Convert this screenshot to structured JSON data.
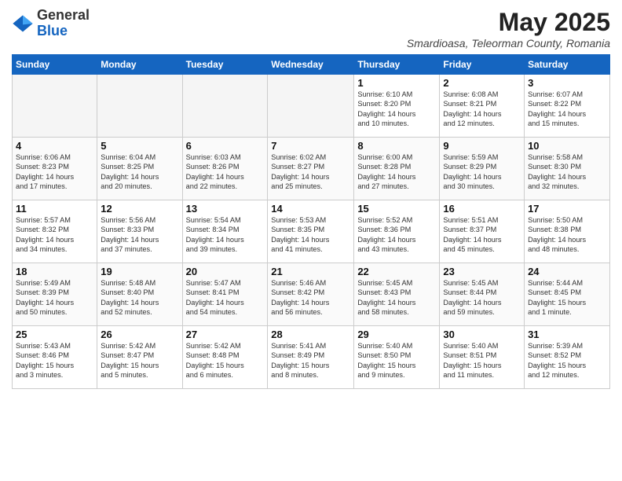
{
  "header": {
    "logo_general": "General",
    "logo_blue": "Blue",
    "month_year": "May 2025",
    "subtitle": "Smardioasa, Teleorman County, Romania"
  },
  "days_of_week": [
    "Sunday",
    "Monday",
    "Tuesday",
    "Wednesday",
    "Thursday",
    "Friday",
    "Saturday"
  ],
  "weeks": [
    [
      {
        "day": "",
        "info": ""
      },
      {
        "day": "",
        "info": ""
      },
      {
        "day": "",
        "info": ""
      },
      {
        "day": "",
        "info": ""
      },
      {
        "day": "1",
        "info": "Sunrise: 6:10 AM\nSunset: 8:20 PM\nDaylight: 14 hours\nand 10 minutes."
      },
      {
        "day": "2",
        "info": "Sunrise: 6:08 AM\nSunset: 8:21 PM\nDaylight: 14 hours\nand 12 minutes."
      },
      {
        "day": "3",
        "info": "Sunrise: 6:07 AM\nSunset: 8:22 PM\nDaylight: 14 hours\nand 15 minutes."
      }
    ],
    [
      {
        "day": "4",
        "info": "Sunrise: 6:06 AM\nSunset: 8:23 PM\nDaylight: 14 hours\nand 17 minutes."
      },
      {
        "day": "5",
        "info": "Sunrise: 6:04 AM\nSunset: 8:25 PM\nDaylight: 14 hours\nand 20 minutes."
      },
      {
        "day": "6",
        "info": "Sunrise: 6:03 AM\nSunset: 8:26 PM\nDaylight: 14 hours\nand 22 minutes."
      },
      {
        "day": "7",
        "info": "Sunrise: 6:02 AM\nSunset: 8:27 PM\nDaylight: 14 hours\nand 25 minutes."
      },
      {
        "day": "8",
        "info": "Sunrise: 6:00 AM\nSunset: 8:28 PM\nDaylight: 14 hours\nand 27 minutes."
      },
      {
        "day": "9",
        "info": "Sunrise: 5:59 AM\nSunset: 8:29 PM\nDaylight: 14 hours\nand 30 minutes."
      },
      {
        "day": "10",
        "info": "Sunrise: 5:58 AM\nSunset: 8:30 PM\nDaylight: 14 hours\nand 32 minutes."
      }
    ],
    [
      {
        "day": "11",
        "info": "Sunrise: 5:57 AM\nSunset: 8:32 PM\nDaylight: 14 hours\nand 34 minutes."
      },
      {
        "day": "12",
        "info": "Sunrise: 5:56 AM\nSunset: 8:33 PM\nDaylight: 14 hours\nand 37 minutes."
      },
      {
        "day": "13",
        "info": "Sunrise: 5:54 AM\nSunset: 8:34 PM\nDaylight: 14 hours\nand 39 minutes."
      },
      {
        "day": "14",
        "info": "Sunrise: 5:53 AM\nSunset: 8:35 PM\nDaylight: 14 hours\nand 41 minutes."
      },
      {
        "day": "15",
        "info": "Sunrise: 5:52 AM\nSunset: 8:36 PM\nDaylight: 14 hours\nand 43 minutes."
      },
      {
        "day": "16",
        "info": "Sunrise: 5:51 AM\nSunset: 8:37 PM\nDaylight: 14 hours\nand 45 minutes."
      },
      {
        "day": "17",
        "info": "Sunrise: 5:50 AM\nSunset: 8:38 PM\nDaylight: 14 hours\nand 48 minutes."
      }
    ],
    [
      {
        "day": "18",
        "info": "Sunrise: 5:49 AM\nSunset: 8:39 PM\nDaylight: 14 hours\nand 50 minutes."
      },
      {
        "day": "19",
        "info": "Sunrise: 5:48 AM\nSunset: 8:40 PM\nDaylight: 14 hours\nand 52 minutes."
      },
      {
        "day": "20",
        "info": "Sunrise: 5:47 AM\nSunset: 8:41 PM\nDaylight: 14 hours\nand 54 minutes."
      },
      {
        "day": "21",
        "info": "Sunrise: 5:46 AM\nSunset: 8:42 PM\nDaylight: 14 hours\nand 56 minutes."
      },
      {
        "day": "22",
        "info": "Sunrise: 5:45 AM\nSunset: 8:43 PM\nDaylight: 14 hours\nand 58 minutes."
      },
      {
        "day": "23",
        "info": "Sunrise: 5:45 AM\nSunset: 8:44 PM\nDaylight: 14 hours\nand 59 minutes."
      },
      {
        "day": "24",
        "info": "Sunrise: 5:44 AM\nSunset: 8:45 PM\nDaylight: 15 hours\nand 1 minute."
      }
    ],
    [
      {
        "day": "25",
        "info": "Sunrise: 5:43 AM\nSunset: 8:46 PM\nDaylight: 15 hours\nand 3 minutes."
      },
      {
        "day": "26",
        "info": "Sunrise: 5:42 AM\nSunset: 8:47 PM\nDaylight: 15 hours\nand 5 minutes."
      },
      {
        "day": "27",
        "info": "Sunrise: 5:42 AM\nSunset: 8:48 PM\nDaylight: 15 hours\nand 6 minutes."
      },
      {
        "day": "28",
        "info": "Sunrise: 5:41 AM\nSunset: 8:49 PM\nDaylight: 15 hours\nand 8 minutes."
      },
      {
        "day": "29",
        "info": "Sunrise: 5:40 AM\nSunset: 8:50 PM\nDaylight: 15 hours\nand 9 minutes."
      },
      {
        "day": "30",
        "info": "Sunrise: 5:40 AM\nSunset: 8:51 PM\nDaylight: 15 hours\nand 11 minutes."
      },
      {
        "day": "31",
        "info": "Sunrise: 5:39 AM\nSunset: 8:52 PM\nDaylight: 15 hours\nand 12 minutes."
      }
    ]
  ]
}
